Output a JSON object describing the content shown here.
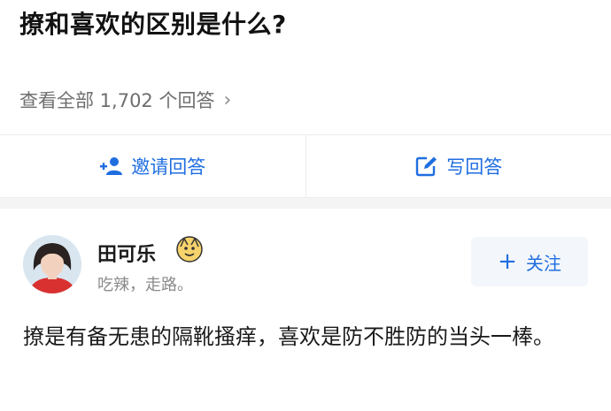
{
  "question": {
    "title": "撩和喜欢的区别是什么?",
    "view_all_label": "查看全部 1,702 个回答",
    "chevron": "›"
  },
  "actions": {
    "invite_label": "邀请回答",
    "invite_icon": "add-person-icon",
    "write_label": "写回答",
    "write_icon": "edit-icon"
  },
  "answer": {
    "author_name": "田可乐",
    "author_bio": "吃辣，走路。",
    "follow_label": "关注",
    "follow_plus": "+",
    "text": "撩是有备无患的隔靴搔痒，喜欢是防不胜防的当头一棒。"
  },
  "colors": {
    "accent": "#1f6ee0",
    "muted": "#8a8a8a",
    "title": "#121212"
  }
}
